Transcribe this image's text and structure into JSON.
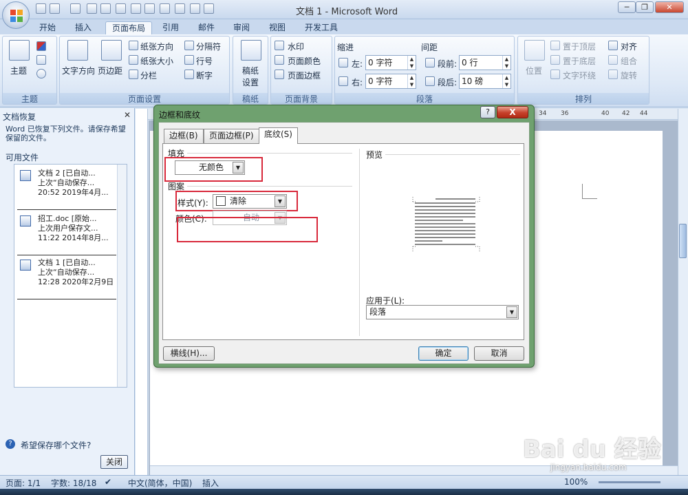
{
  "window": {
    "title": "文档 1 - Microsoft Word",
    "min": "─",
    "restore": "❐",
    "close": "✕"
  },
  "tabs": [
    "开始",
    "插入",
    "页面布局",
    "引用",
    "邮件",
    "审阅",
    "视图",
    "开发工具"
  ],
  "active_tab": "页面布局",
  "ribbon": {
    "theme": {
      "btn": "主题",
      "label": "主题"
    },
    "page_setup": {
      "text_dir": "文字方向",
      "margins": "页边距",
      "orientation": "纸张方向",
      "size": "纸张大小",
      "columns": "分栏",
      "breaks": "分隔符",
      "line_numbers": "行号",
      "hyphen": "断字",
      "label": "页面设置"
    },
    "draft": {
      "btn1": "稿纸",
      "btn2": "设置",
      "label": "稿纸"
    },
    "page_bg": {
      "watermark": "水印",
      "page_color": "页面颜色",
      "page_border": "页面边框",
      "label": "页面背景"
    },
    "paragraph": {
      "indent": "缩进",
      "left": "左:",
      "left_val": "0 字符",
      "right": "右:",
      "right_val": "0 字符",
      "spacing": "间距",
      "before": "段前:",
      "before_val": "0 行",
      "after": "段后:",
      "after_val": "10 磅",
      "label": "段落"
    },
    "arrange": {
      "position": "位置",
      "front": "置于顶层",
      "back": "置于底层",
      "wrap": "文字环绕",
      "align": "对齐",
      "group": "组合",
      "rotate": "旋转",
      "label": "排列"
    }
  },
  "recovery": {
    "title": "文档恢复",
    "message": "Word 已恢复下列文件。请保存希望保留的文件。",
    "available": "可用文件",
    "files": [
      {
        "name": "文档 2 [已自动...",
        "line2": "上次“自动保存...",
        "line3": "20:52 2019年4月..."
      },
      {
        "name": "招工.doc [原始...",
        "line2": "上次用户保存文...",
        "line3": "11:22 2014年8月..."
      },
      {
        "name": "文档 1 [已自动...",
        "line2": "上次“自动保存...",
        "line3": "12:28 2020年2月9日"
      }
    ],
    "help": "希望保存哪个文件?",
    "close": "关闭"
  },
  "ruler_numbers": [
    "34",
    "36",
    "40",
    "42",
    "44"
  ],
  "dialog": {
    "title": "边框和底纹",
    "help": "?",
    "close": "X",
    "tabs": [
      "边框(B)",
      "页面边框(P)",
      "底纹(S)"
    ],
    "fill_label": "填充",
    "fill_value": "无颜色",
    "pattern_label": "图案",
    "style_label": "样式(Y):",
    "style_value": "清除",
    "color_label": "颜色(C):",
    "color_value": "自动",
    "preview_label": "预览",
    "apply_label": "应用于(L):",
    "apply_value": "段落",
    "hline_btn": "横线(H)...",
    "ok": "确定",
    "cancel": "取消"
  },
  "status": {
    "page": "页面: 1/1",
    "words": "字数: 18/18",
    "lang": "中文(简体，中国)",
    "mode": "插入",
    "zoom": "100%"
  },
  "watermark": {
    "main": "Bai du 经验",
    "sub": "jingyan.baidu.com"
  },
  "colors": {
    "accent": "#1e395b",
    "dialog_frame": "#6fa16f",
    "highlight": "#d8283a",
    "close_red": "#c6402a"
  }
}
